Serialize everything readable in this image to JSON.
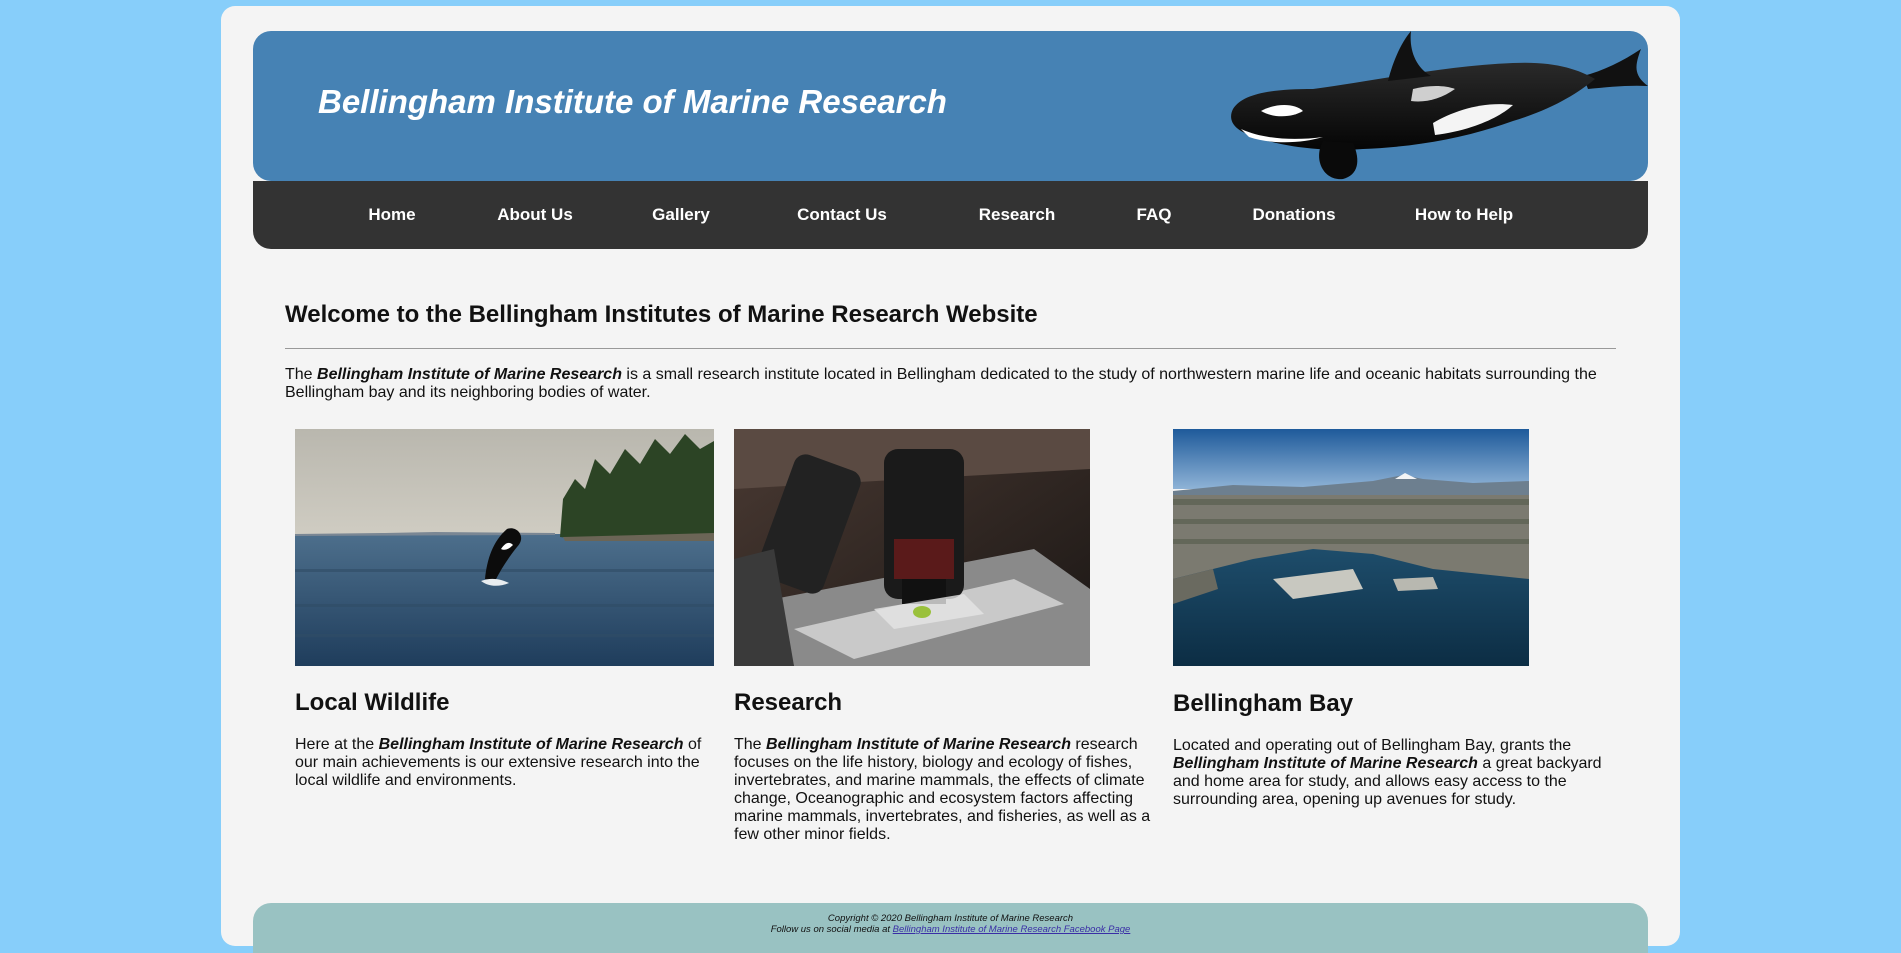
{
  "header": {
    "title": "Bellingham Institute of Marine Research",
    "logo_icon": "orca-icon"
  },
  "nav": {
    "items": [
      {
        "label": "Home"
      },
      {
        "label": "About Us"
      },
      {
        "label": "Gallery"
      },
      {
        "label": "Contact Us"
      },
      {
        "label": "Research"
      },
      {
        "label": "FAQ"
      },
      {
        "label": "Donations"
      },
      {
        "label": "How to Help"
      }
    ]
  },
  "main": {
    "heading": "Welcome to the Bellingham Institutes of Marine Research Website",
    "intro": {
      "prefix": "The ",
      "name": "Bellingham Institute of Marine Research",
      "suffix": " is a small research institute located in Bellingham dedicated to the study of northwestern marine life and oceanic habitats surrounding the Bellingham bay and its neighboring bodies of water."
    },
    "columns": [
      {
        "title": "Local Wildlife",
        "image": "orca-breaching-photo",
        "text_prefix": "Here at the ",
        "text_name": "Bellingham Institute of Marine Research",
        "text_suffix": " of our main achievements is our extensive research into the local wildlife and environments."
      },
      {
        "title": "Research",
        "image": "microscope-photo",
        "text_prefix": "The ",
        "text_name": "Bellingham Institute of Marine Research",
        "text_suffix": " research focuses on the life history, biology and ecology of fishes, invertebrates, and marine mammals, the effects of climate change, Oceanographic and ecosystem factors affecting marine mammals, invertebrates, and fisheries, as well as a few other minor fields."
      },
      {
        "title": "Bellingham Bay",
        "image": "bellingham-bay-aerial-photo",
        "text_prefix": "Located and operating out of Bellingham Bay, grants the ",
        "text_name": "Bellingham Institute of Marine Research",
        "text_suffix": " a great backyard and home area for study, and allows easy access to the surrounding area, opening up avenues for study."
      }
    ]
  },
  "footer": {
    "copyright": "Copyright © 2020 Bellingham Institute of Marine Research",
    "social_prefix": "Follow us on social media at ",
    "social_link": "Bellingham Institute of Marine Research Facebook Page"
  },
  "colors": {
    "background": "#87cefa",
    "header": "#4682b4",
    "nav": "#333333",
    "footer": "#99c2c2",
    "page": "#f4f4f4"
  }
}
